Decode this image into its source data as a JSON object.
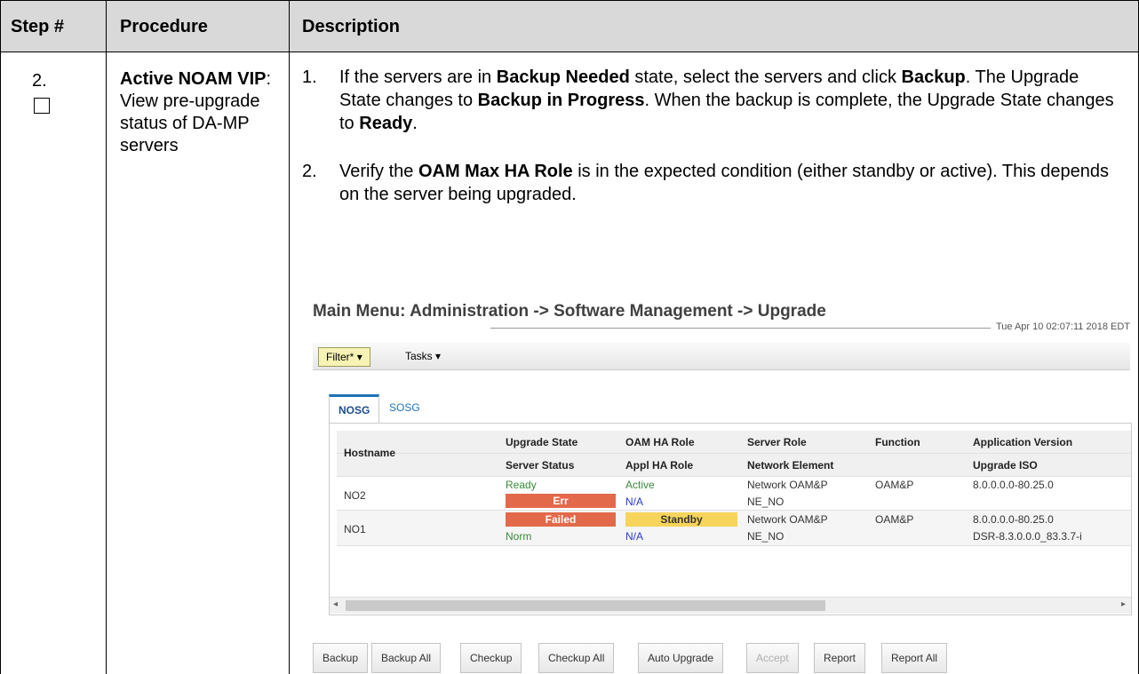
{
  "headers": {
    "step": "Step #",
    "procedure": "Procedure",
    "description": "Description"
  },
  "step": {
    "number": "2.",
    "checkbox": "unchecked"
  },
  "procedure": {
    "bold": "Active NOAM VIP",
    "text": ": View pre-upgrade status of DA-MP servers"
  },
  "description": {
    "items": [
      {
        "num": "1.",
        "parts": [
          {
            "t": "If the servers are in ",
            "b": false
          },
          {
            "t": "Backup Needed",
            "b": true
          },
          {
            "t": " state, select the servers and click ",
            "b": false
          },
          {
            "t": "Backup",
            "b": true
          },
          {
            "t": ".  The Upgrade State changes to ",
            "b": false
          },
          {
            "t": "Backup in Progress",
            "b": true
          },
          {
            "t": ".  When the backup is complete, the Upgrade State changes to ",
            "b": false
          },
          {
            "t": "Ready",
            "b": true
          },
          {
            "t": ".",
            "b": false
          }
        ]
      },
      {
        "num": "2.",
        "parts": [
          {
            "t": "Verify the ",
            "b": false
          },
          {
            "t": "OAM Max HA Role",
            "b": true
          },
          {
            "t": " is in the expected condition (either standby or active).  This depends on the server being upgraded.",
            "b": false
          }
        ]
      }
    ]
  },
  "screenshot": {
    "menu_title": "Main Menu: Administration -> Software Management -> Upgrade",
    "timestamp": "Tue Apr 10 02:07:11 2018 EDT",
    "toolbar": {
      "filter": "Filter*",
      "tasks": "Tasks"
    },
    "tabs": [
      "NOSG",
      "SOSG"
    ],
    "columns": [
      {
        "top": "Hostname",
        "bottom": ""
      },
      {
        "top": "Upgrade State",
        "bottom": "Server Status"
      },
      {
        "top": "OAM HA Role",
        "bottom": "Appl HA Role"
      },
      {
        "top": "Server Role",
        "bottom": "Network Element"
      },
      {
        "top": "Function",
        "bottom": ""
      },
      {
        "top": "Application Version",
        "bottom": "Upgrade ISO"
      }
    ],
    "rows": [
      {
        "hostname": "NO2",
        "upgrade_state": "Ready",
        "server_status": "Err",
        "oam_ha_role": "Active",
        "appl_ha_role": "N/A",
        "server_role": "Network OAM&P",
        "network_element": "NE_NO",
        "function": "OAM&P",
        "app_version": "8.0.0.0.0-80.25.0",
        "upgrade_iso": ""
      },
      {
        "hostname": "NO1",
        "upgrade_state": "Failed",
        "server_status": "Norm",
        "oam_ha_role": "Standby",
        "appl_ha_role": "N/A",
        "server_role": "Network OAM&P",
        "network_element": "NE_NO",
        "function": "OAM&P",
        "app_version": "8.0.0.0.0-80.25.0",
        "upgrade_iso": "DSR-8.3.0.0.0_83.3.7-i"
      }
    ],
    "buttons": [
      "Backup",
      "Backup All",
      "Checkup",
      "Checkup All",
      "Auto Upgrade",
      "Accept",
      "Report",
      "Report All"
    ],
    "colors": {
      "error": "#e26a4a",
      "standby": "#f7d45a",
      "ok_green": "#3a8a3a",
      "na_blue": "#2a3ad0",
      "tab_accent": "#1e72b8"
    }
  }
}
